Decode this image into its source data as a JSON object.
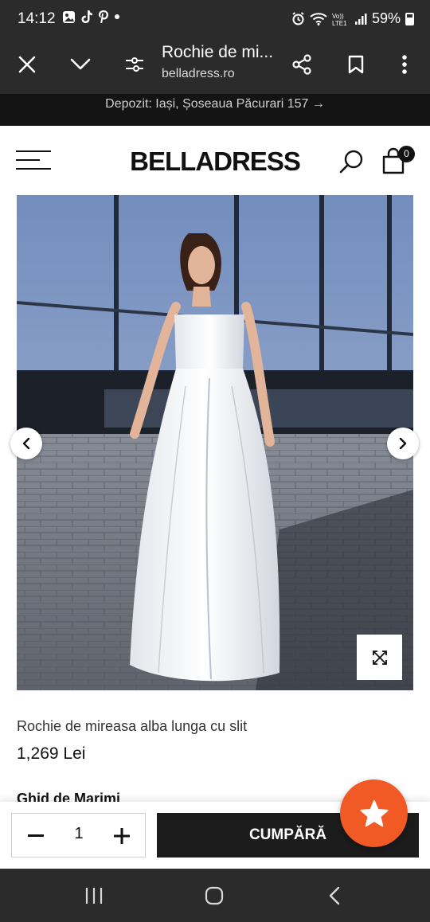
{
  "status_bar": {
    "time": "14:12",
    "notification_icons": [
      "gallery-icon",
      "tiktok-icon",
      "pinterest-icon",
      "dot-icon"
    ],
    "system_icons": [
      "alarm-icon",
      "wifi-icon",
      "volte-icon",
      "signal-icon"
    ],
    "volte_label": "Vo)) LTE1",
    "battery": "59%"
  },
  "browser": {
    "page_title": "Rochie de mi...",
    "url": "belladress.ro"
  },
  "announcement": "Depozit: Iași, Șoseaua Păcurari 157 →",
  "header": {
    "logo": "BELLADRESS",
    "cart_count": "0"
  },
  "product": {
    "name": "Rochie de mireasa alba lunga cu slit",
    "price": "1,269 Lei",
    "size_guide": "Ghid de Marimi",
    "quantity": "1",
    "buy_label": "CUMPĂRĂ"
  },
  "colors": {
    "chrome": "#2b2b2b",
    "announcement_bg": "#141414",
    "buy_button": "#1c1c1c",
    "fab_accent": "#f15a24"
  }
}
